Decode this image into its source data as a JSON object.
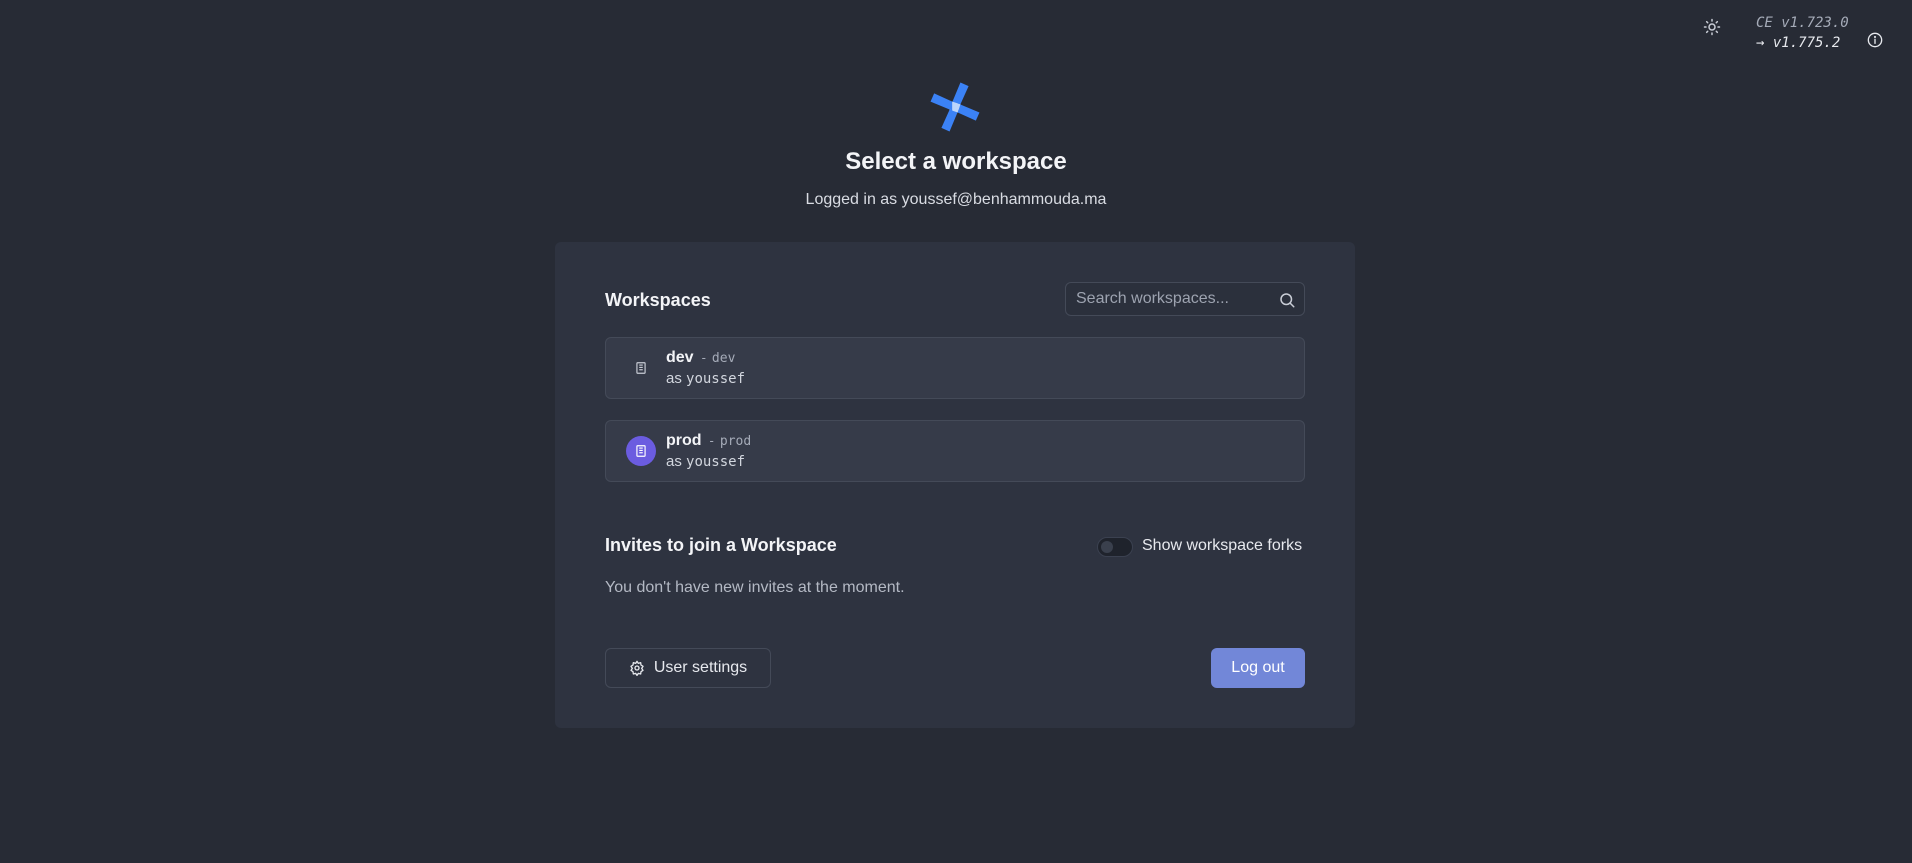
{
  "header": {
    "theme_icon": "sun-icon",
    "version_current": "CE v1.723.0",
    "version_latest": "→ v1.775.2",
    "info_icon": "info-icon",
    "title": "Select a workspace",
    "logged_in_prefix": "Logged in as",
    "user_email": "youssef@benhammouda.ma"
  },
  "workspaces_section": {
    "title": "Workspaces",
    "search_placeholder": "Search workspaces...",
    "search_value": "",
    "items": [
      {
        "name": "dev",
        "separator": "-",
        "id": "dev",
        "as_label": "as",
        "username": "youssef",
        "icon": "building-icon",
        "icon_color": ""
      },
      {
        "name": "prod",
        "separator": "-",
        "id": "prod",
        "as_label": "as",
        "username": "youssef",
        "icon": "building-icon",
        "icon_color": "#6b5ce0"
      }
    ]
  },
  "invites_section": {
    "title": "Invites to join a Workspace",
    "show_forks_label": "Show workspace forks",
    "show_forks_enabled": false,
    "empty_message": "You don't have new invites at the moment."
  },
  "actions": {
    "user_settings_label": "User settings",
    "logout_label": "Log out"
  },
  "colors": {
    "background": "#272b35",
    "card": "#2e3340",
    "accent": "#7287d8",
    "brand_blue": "#3b82f6"
  }
}
